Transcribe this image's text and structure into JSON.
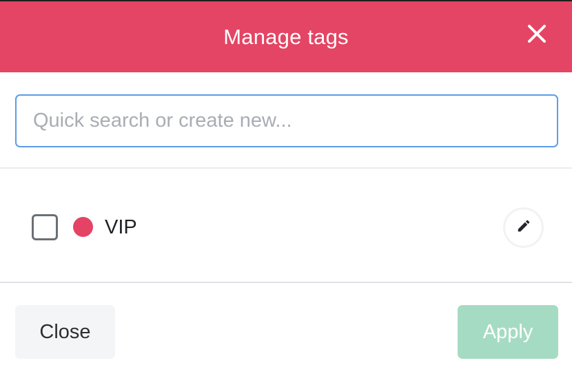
{
  "header": {
    "title": "Manage tags",
    "close_icon": "close-icon"
  },
  "search": {
    "value": "",
    "placeholder": "Quick search or create new..."
  },
  "tags": [
    {
      "label": "VIP",
      "checked": false,
      "color": "#e44366",
      "edit_icon": "pencil-icon"
    }
  ],
  "footer": {
    "close_label": "Close",
    "apply_label": "Apply"
  },
  "colors": {
    "header_bg": "#e44564",
    "accent_blue": "#5b9de8",
    "apply_bg_disabled": "#a6dbc3",
    "close_bg": "#f4f5f7"
  }
}
